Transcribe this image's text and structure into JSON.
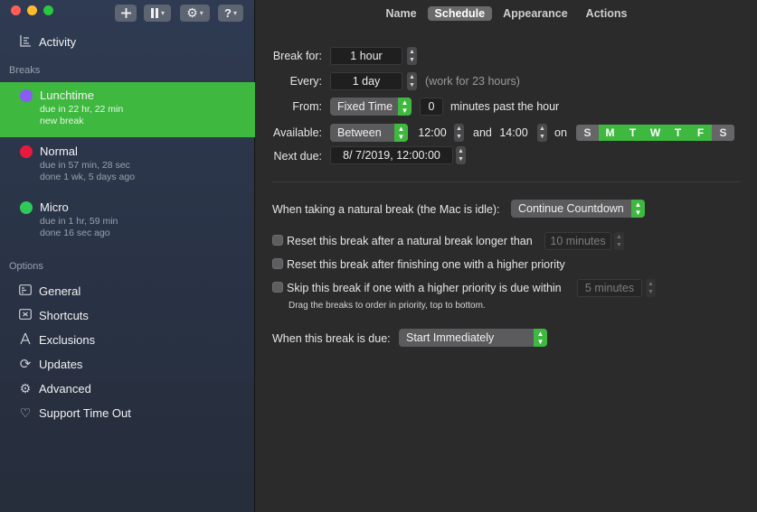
{
  "toolbar": {
    "add_icon": "plus-icon",
    "pause_icon": "pause-icon",
    "settings_icon": "gear-icon",
    "help_label": "?"
  },
  "sidebar": {
    "activity_label": "Activity",
    "breaks_header": "Breaks",
    "breaks": [
      {
        "name": "Lunchtime",
        "line1": "due in 22 hr, 22 min",
        "line2": "new break",
        "color": "#8a5cf6"
      },
      {
        "name": "Normal",
        "line1": "due in 57 min, 28 sec",
        "line2": "done 1 wk, 5 days ago",
        "color": "#e8193f"
      },
      {
        "name": "Micro",
        "line1": "due in 1 hr, 59 min",
        "line2": "done 16 sec ago",
        "color": "#2fc95a"
      }
    ],
    "options_header": "Options",
    "options": [
      {
        "label": "General",
        "icon": "general-icon"
      },
      {
        "label": "Shortcuts",
        "icon": "keyboard-icon"
      },
      {
        "label": "Exclusions",
        "icon": "exclusions-icon"
      },
      {
        "label": "Updates",
        "icon": "refresh-icon"
      },
      {
        "label": "Advanced",
        "icon": "gear-icon"
      },
      {
        "label": "Support Time Out",
        "icon": "heart-icon"
      }
    ]
  },
  "tabs": [
    "Name",
    "Schedule",
    "Appearance",
    "Actions"
  ],
  "active_tab": "Schedule",
  "schedule": {
    "break_for_label": "Break for:",
    "break_for_value": "1 hour",
    "every_label": "Every:",
    "every_value": "1 day",
    "every_note": "(work for 23 hours)",
    "from_label": "From:",
    "from_value": "Fixed Time",
    "from_minutes": "0",
    "from_suffix": "minutes past the hour",
    "available_label": "Available:",
    "available_value": "Between",
    "available_start": "12:00",
    "and_label": "and",
    "available_end": "14:00",
    "on_label": "on",
    "days": [
      {
        "d": "S",
        "on": false
      },
      {
        "d": "M",
        "on": true
      },
      {
        "d": "T",
        "on": true
      },
      {
        "d": "W",
        "on": true
      },
      {
        "d": "T",
        "on": true
      },
      {
        "d": "F",
        "on": true
      },
      {
        "d": "S",
        "on": false
      }
    ],
    "next_due_label": "Next due:",
    "next_due_value": "8/  7/2019, 12:00:00"
  },
  "natural": {
    "label": "When taking a natural break (the Mac is idle):",
    "value": "Continue Countdown",
    "reset_natural_label": "Reset this break after a natural break longer than",
    "reset_natural_value": "10 minutes",
    "reset_priority_label": "Reset this break after finishing one with a higher priority",
    "skip_label": "Skip this break if one with a higher priority is due within",
    "skip_value": "5 minutes",
    "drag_note": "Drag the breaks to order in priority, top to bottom."
  },
  "due": {
    "label": "When this break is due:",
    "value": "Start Immediately"
  },
  "colors": {
    "accent": "#3eb83f",
    "sidebar_bg": "#2c3649",
    "main_bg": "#2b2b2c"
  }
}
